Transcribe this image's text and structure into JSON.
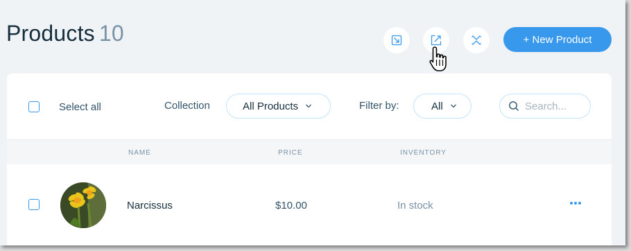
{
  "header": {
    "title": "Products",
    "count": "10",
    "import_icon": "import-icon",
    "export_icon": "export-icon",
    "sort_icon": "reorder-icon",
    "new_button_label": "+ New Product"
  },
  "toolbar": {
    "select_all_label": "Select all",
    "collection_label": "Collection",
    "collection_value": "All Products",
    "filter_label": "Filter by:",
    "filter_value": "All",
    "search_placeholder": "Search..."
  },
  "table": {
    "columns": [
      "NAME",
      "PRICE",
      "INVENTORY"
    ],
    "rows": [
      {
        "name": "Narcissus",
        "price": "$10.00",
        "inventory": "In stock",
        "image": "daffodil-thumbnail",
        "menu_icon": "more-icon"
      }
    ]
  },
  "colors": {
    "accent": "#3899ec",
    "title": "#162d3d",
    "muted": "#7a92a5",
    "background": "#eff3f6"
  }
}
